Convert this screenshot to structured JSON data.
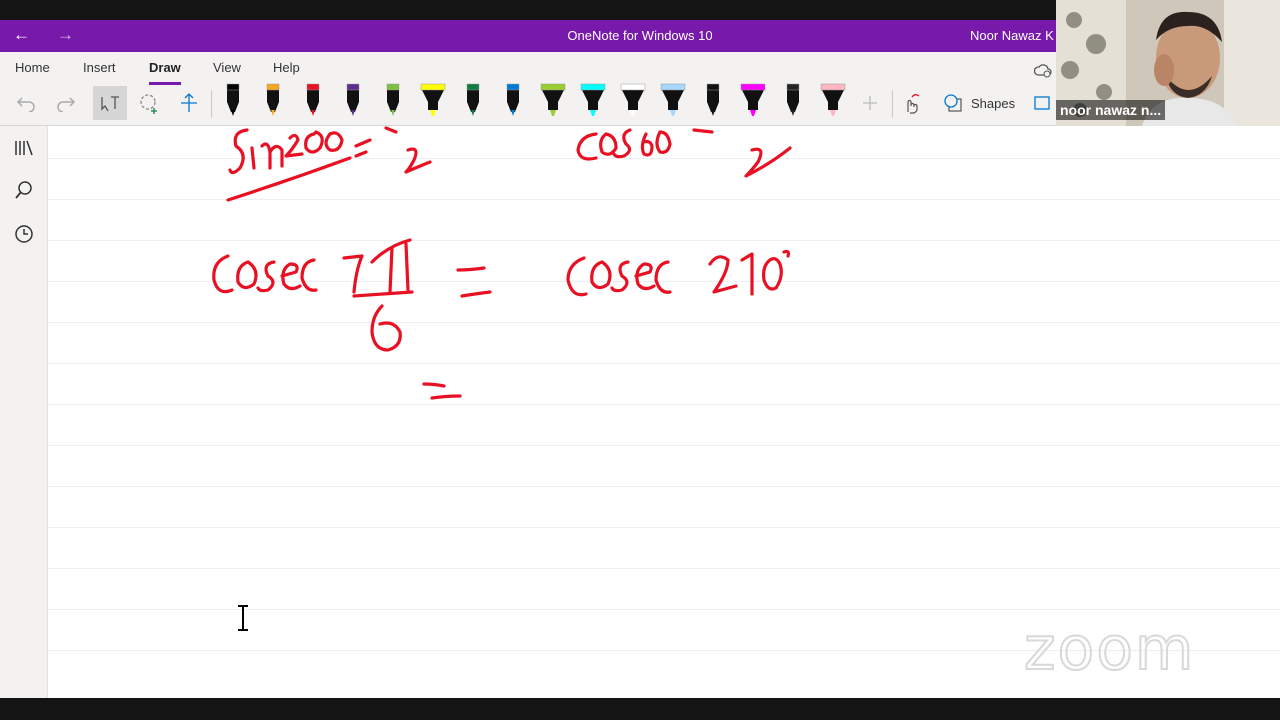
{
  "title_bar": {
    "back_label": "←",
    "forward_label": "→",
    "title": "OneNote for Windows 10",
    "user": "Noor Nawaz K"
  },
  "ribbon": {
    "tabs": [
      {
        "label": "Home"
      },
      {
        "label": "Insert"
      },
      {
        "label": "Draw",
        "active": true
      },
      {
        "label": "View"
      },
      {
        "label": "Help"
      }
    ],
    "shapes_label": "Shapes",
    "pens": [
      {
        "name": "black-pen",
        "color": "#000000"
      },
      {
        "name": "orange-pencil",
        "color": "#f5a623"
      },
      {
        "name": "red-pen",
        "color": "#e81123"
      },
      {
        "name": "purple-pen",
        "color": "#5c2d91"
      },
      {
        "name": "green-galaxy-pen",
        "color": "#7cc142"
      },
      {
        "name": "yellow-highlighter",
        "color": "#ffff00"
      },
      {
        "name": "dark-green-pen",
        "color": "#107c41"
      },
      {
        "name": "blue-pen",
        "color": "#0078d4"
      },
      {
        "name": "lime-highlighter",
        "color": "#9acd32"
      },
      {
        "name": "cyan-highlighter",
        "color": "#00ffff"
      },
      {
        "name": "white-highlighter",
        "color": "#ffffff"
      },
      {
        "name": "light-blue-highlighter",
        "color": "#a6d8ff"
      },
      {
        "name": "black-pen-2",
        "color": "#111111"
      },
      {
        "name": "magenta-highlighter",
        "color": "#ff00ff"
      },
      {
        "name": "black-galaxy-pen",
        "color": "#222222"
      },
      {
        "name": "pink-highlighter",
        "color": "#ffb6c1"
      }
    ]
  },
  "video": {
    "participant_name": "noor nawaz n..."
  },
  "watermark": "zoom",
  "ink_color": "#e81123",
  "accent_color": "#7719aa"
}
